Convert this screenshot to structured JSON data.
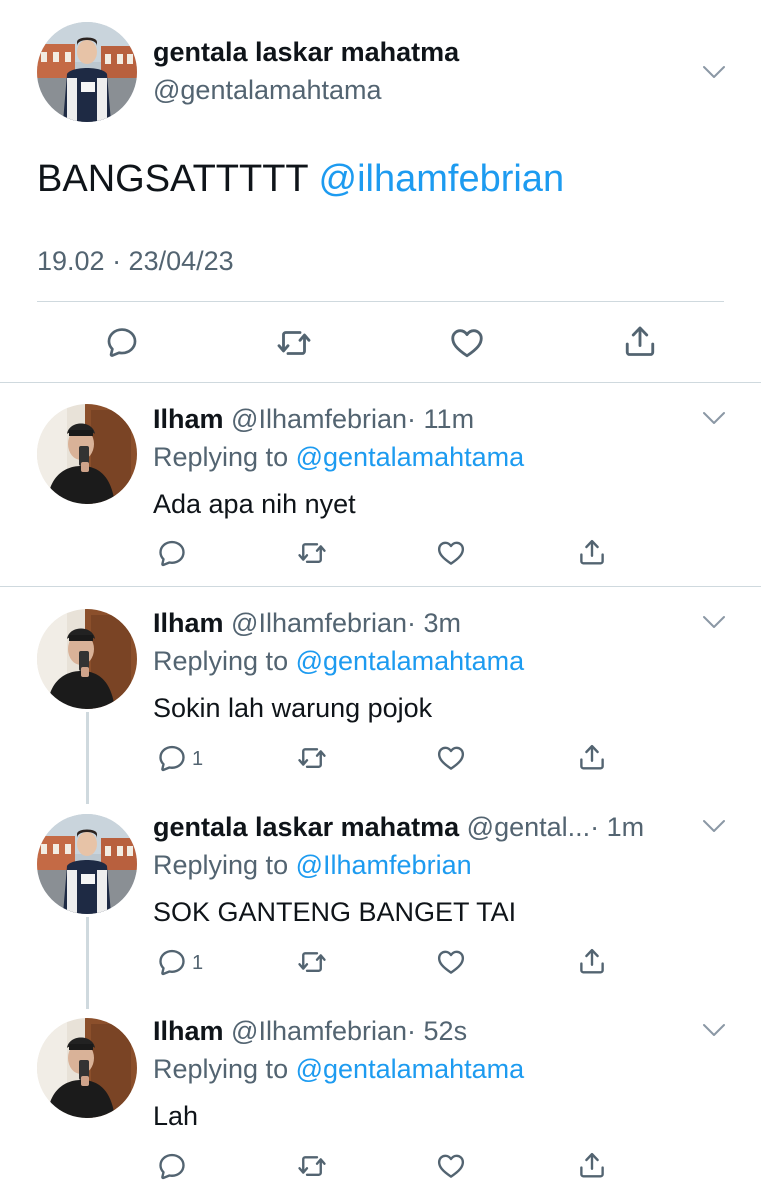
{
  "main_tweet": {
    "name": "gentala laskar mahatma",
    "handle": "@gentalamahtama",
    "text": "BANGSATTTTT",
    "mention": "@ilhamfebrian",
    "timestamp": "19.02 · 23/04/23",
    "actions": [
      "reply-icon",
      "retweet-icon",
      "like-icon",
      "share-icon"
    ]
  },
  "replies": [
    {
      "name": "Ilham",
      "handle": "@Ilhamfebrian",
      "time": "· 11m",
      "replying_label": "Replying to",
      "replying_to": "@gentalamahtama",
      "text": "Ada apa nih nyet",
      "reply_count": ""
    },
    {
      "name": "Ilham",
      "handle": "@Ilhamfebrian",
      "time": "· 3m",
      "replying_label": "Replying to",
      "replying_to": "@gentalamahtama",
      "text": "Sokin lah warung pojok",
      "reply_count": "1"
    },
    {
      "name": "gentala laskar mahatma",
      "handle": "@gental...",
      "time": "· 1m",
      "replying_label": "Replying to",
      "replying_to": "@Ilhamfebrian",
      "text": "SOK GANTENG BANGET TAI",
      "reply_count": "1"
    },
    {
      "name": "Ilham",
      "handle": "@Ilhamfebrian",
      "time": "· 52s",
      "replying_label": "Replying to",
      "replying_to": "@gentalamahtama",
      "text": "Lah",
      "reply_count": ""
    }
  ],
  "colors": {
    "text": "#0f1419",
    "secondary": "#536471",
    "link": "#1d9bf0",
    "divider": "#cfd9de"
  }
}
